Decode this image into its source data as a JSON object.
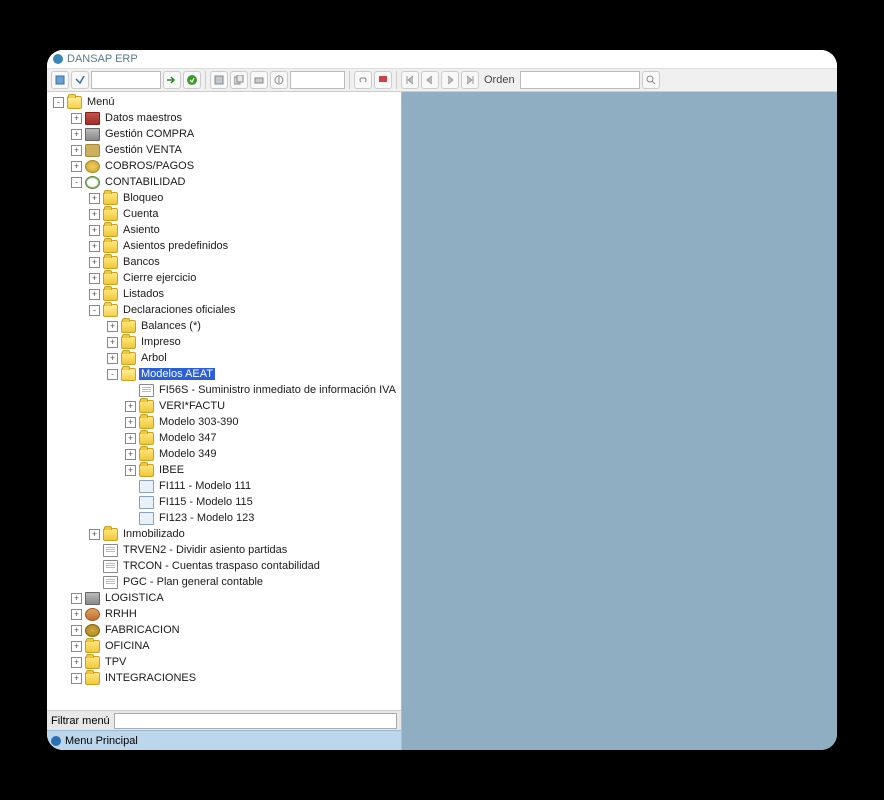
{
  "title": "DANSAP ERP",
  "toolbar": {
    "order_label": "Orden",
    "search_value": "",
    "order_value": ""
  },
  "filter": {
    "label": "Filtrar menú",
    "value": ""
  },
  "footer": {
    "label": "Menu Principal"
  },
  "tree": [
    {
      "d": 0,
      "exp": "-",
      "ico": "folder-open",
      "lbl": "Menú"
    },
    {
      "d": 1,
      "exp": "+",
      "ico": "book",
      "lbl": "Datos maestros"
    },
    {
      "d": 1,
      "exp": "+",
      "ico": "truck",
      "lbl": "Gestión COMPRA"
    },
    {
      "d": 1,
      "exp": "+",
      "ico": "cart",
      "lbl": "Gestión VENTA"
    },
    {
      "d": 1,
      "exp": "+",
      "ico": "coins",
      "lbl": "COBROS/PAGOS"
    },
    {
      "d": 1,
      "exp": "-",
      "ico": "clock",
      "lbl": "CONTABILIDAD"
    },
    {
      "d": 2,
      "exp": "+",
      "ico": "folder",
      "lbl": "Bloqueo"
    },
    {
      "d": 2,
      "exp": "+",
      "ico": "folder",
      "lbl": "Cuenta"
    },
    {
      "d": 2,
      "exp": "+",
      "ico": "folder",
      "lbl": "Asiento"
    },
    {
      "d": 2,
      "exp": "+",
      "ico": "folder",
      "lbl": "Asientos predefinidos"
    },
    {
      "d": 2,
      "exp": "+",
      "ico": "folder",
      "lbl": "Bancos"
    },
    {
      "d": 2,
      "exp": "+",
      "ico": "folder",
      "lbl": "Cierre ejercicio"
    },
    {
      "d": 2,
      "exp": "+",
      "ico": "folder",
      "lbl": "Listados"
    },
    {
      "d": 2,
      "exp": "-",
      "ico": "folder-open",
      "lbl": "Declaraciones oficiales"
    },
    {
      "d": 3,
      "exp": "+",
      "ico": "folder",
      "lbl": "Balances (*)"
    },
    {
      "d": 3,
      "exp": "+",
      "ico": "folder",
      "lbl": "Impreso"
    },
    {
      "d": 3,
      "exp": "+",
      "ico": "folder",
      "lbl": "Arbol"
    },
    {
      "d": 3,
      "exp": "-",
      "ico": "folder-open",
      "lbl": "Modelos AEAT",
      "sel": true
    },
    {
      "d": 4,
      "exp": " ",
      "ico": "doc",
      "lbl": "FI56S - Suministro inmediato de información IVA"
    },
    {
      "d": 4,
      "exp": "+",
      "ico": "folder",
      "lbl": "VERI*FACTU"
    },
    {
      "d": 4,
      "exp": "+",
      "ico": "folder",
      "lbl": "Modelo 303-390"
    },
    {
      "d": 4,
      "exp": "+",
      "ico": "folder",
      "lbl": "Modelo 347"
    },
    {
      "d": 4,
      "exp": "+",
      "ico": "folder",
      "lbl": "Modelo 349"
    },
    {
      "d": 4,
      "exp": "+",
      "ico": "folder",
      "lbl": "IBEE"
    },
    {
      "d": 4,
      "exp": " ",
      "ico": "sheet",
      "lbl": "FI111 - Modelo 111"
    },
    {
      "d": 4,
      "exp": " ",
      "ico": "sheet",
      "lbl": "FI115 - Modelo 115"
    },
    {
      "d": 4,
      "exp": " ",
      "ico": "sheet",
      "lbl": "FI123 - Modelo 123"
    },
    {
      "d": 2,
      "exp": "+",
      "ico": "folder",
      "lbl": "Inmobilizado"
    },
    {
      "d": 2,
      "exp": " ",
      "ico": "doc",
      "lbl": "TRVEN2 - Dividir asiento partidas"
    },
    {
      "d": 2,
      "exp": " ",
      "ico": "doc",
      "lbl": "TRCON - Cuentas traspaso contabilidad"
    },
    {
      "d": 2,
      "exp": " ",
      "ico": "doc",
      "lbl": "PGC - Plan general contable"
    },
    {
      "d": 1,
      "exp": "+",
      "ico": "truck",
      "lbl": "LOGISTICA"
    },
    {
      "d": 1,
      "exp": "+",
      "ico": "person",
      "lbl": "RRHH"
    },
    {
      "d": 1,
      "exp": "+",
      "ico": "gear",
      "lbl": "FABRICACION"
    },
    {
      "d": 1,
      "exp": "+",
      "ico": "folder",
      "lbl": "OFICINA"
    },
    {
      "d": 1,
      "exp": "+",
      "ico": "folder",
      "lbl": "TPV"
    },
    {
      "d": 1,
      "exp": "+",
      "ico": "folder",
      "lbl": "INTEGRACIONES"
    }
  ]
}
